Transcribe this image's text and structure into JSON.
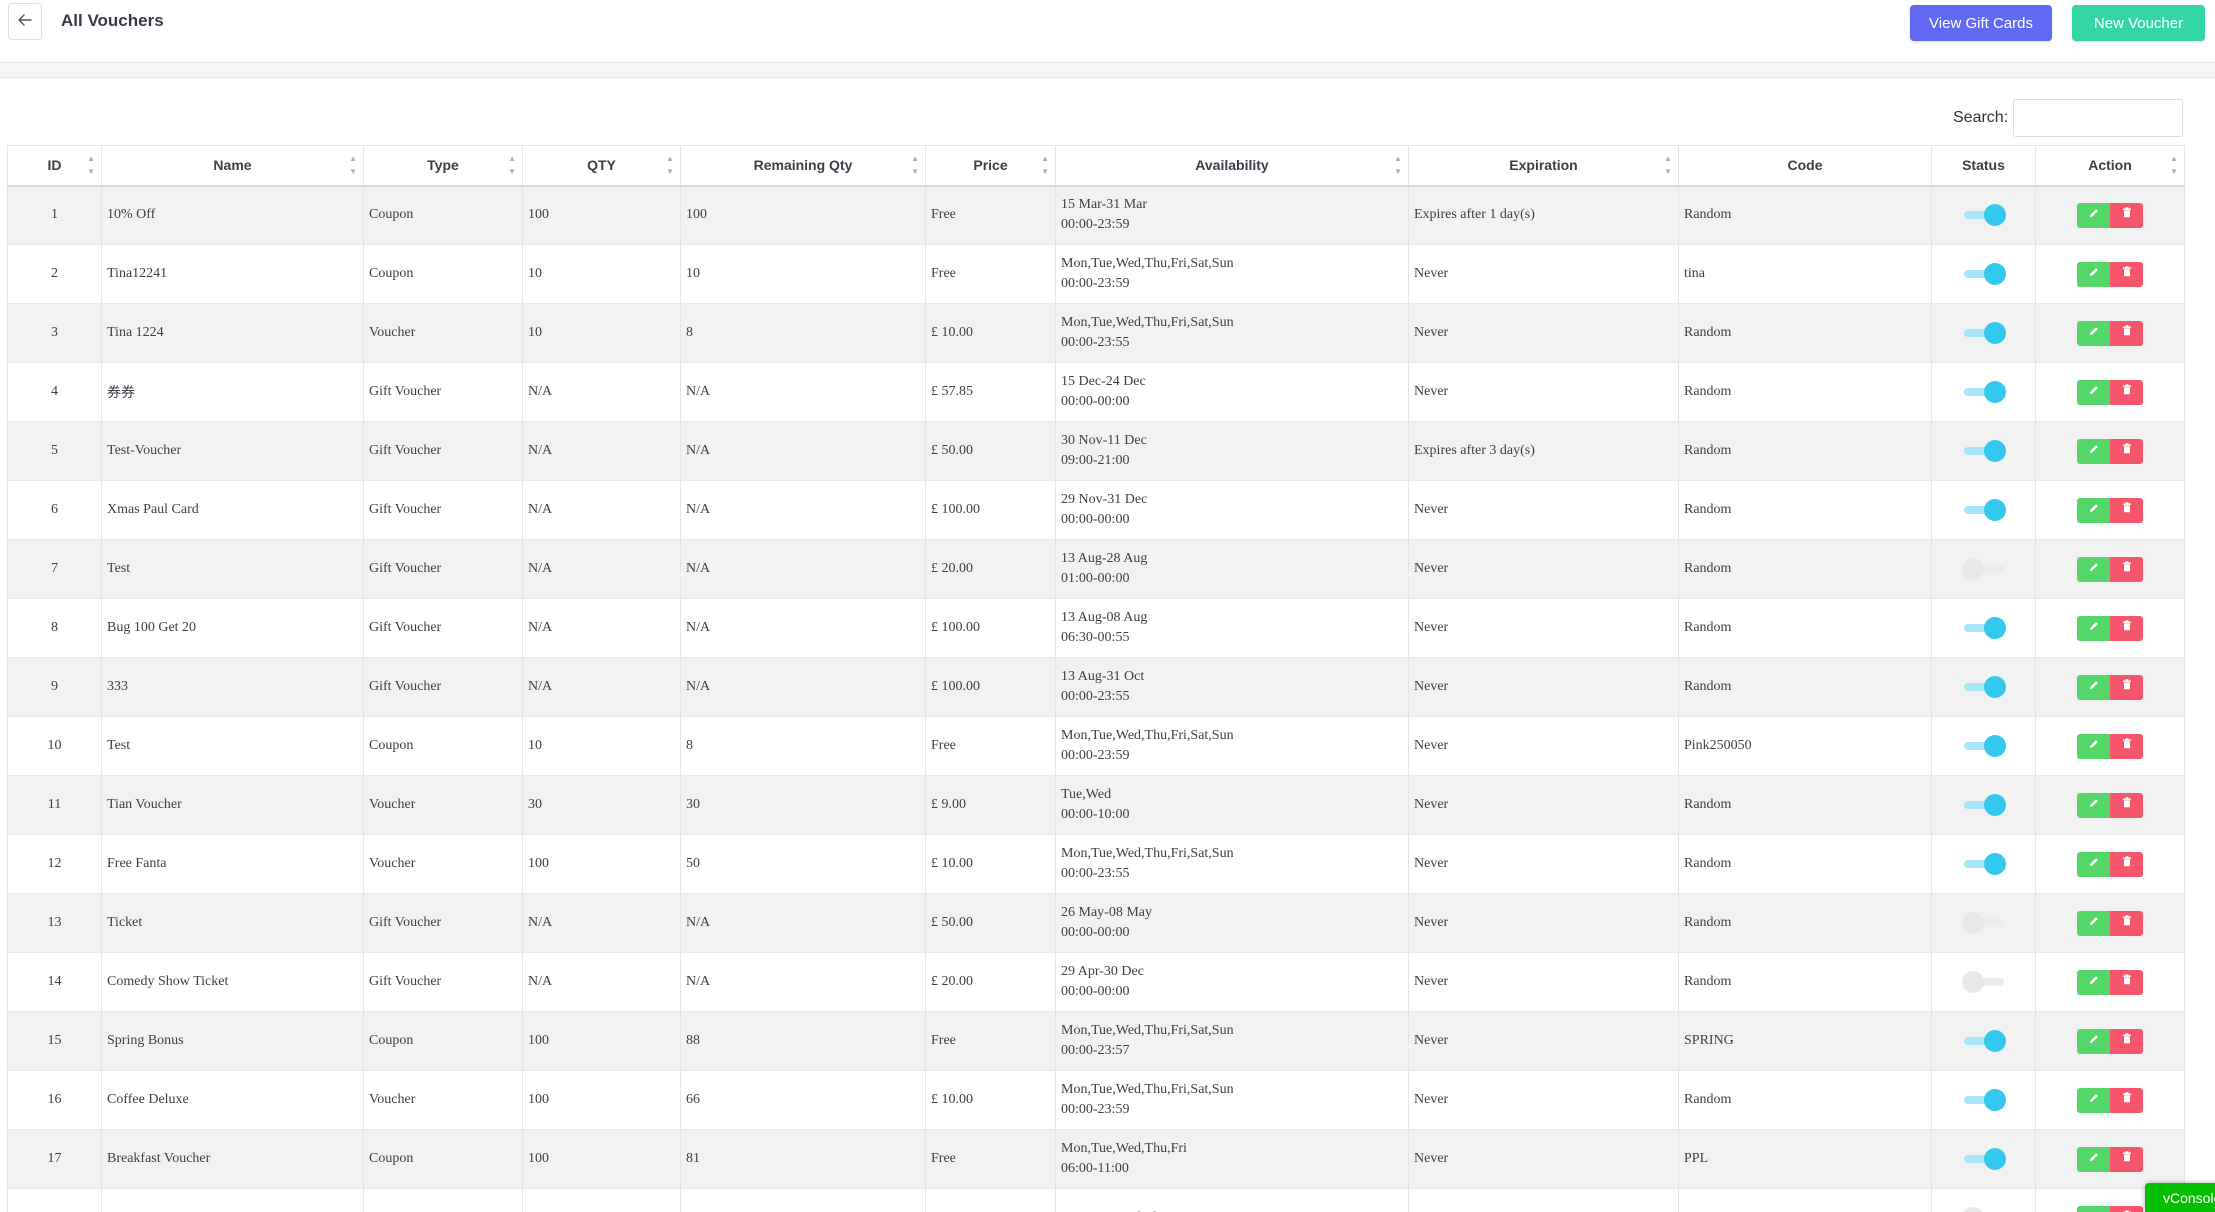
{
  "header": {
    "title": "All Vouchers",
    "view_gift_cards_label": "View Gift Cards",
    "new_voucher_label": "New Voucher"
  },
  "search": {
    "label": "Search:",
    "value": ""
  },
  "table": {
    "columns": [
      "ID",
      "Name",
      "Type",
      "QTY",
      "Remaining Qty",
      "Price",
      "Availability",
      "Expiration",
      "Code",
      "Status",
      "Action"
    ],
    "rows": [
      {
        "id": "1",
        "name": "10% Off",
        "type": "Coupon",
        "qty": "100",
        "remaining": "100",
        "price": "Free",
        "availability": [
          "15 Mar-31 Mar",
          "00:00-23:59"
        ],
        "expiration": "Expires after 1 day(s)",
        "code": "Random",
        "status": true
      },
      {
        "id": "2",
        "name": "Tina12241",
        "type": "Coupon",
        "qty": "10",
        "remaining": "10",
        "price": "Free",
        "availability": [
          "Mon,Tue,Wed,Thu,Fri,Sat,Sun",
          "00:00-23:59"
        ],
        "expiration": "Never",
        "code": "tina",
        "status": true
      },
      {
        "id": "3",
        "name": "Tina 1224",
        "type": "Voucher",
        "qty": "10",
        "remaining": "8",
        "price": "£ 10.00",
        "availability": [
          "Mon,Tue,Wed,Thu,Fri,Sat,Sun",
          "00:00-23:55"
        ],
        "expiration": "Never",
        "code": "Random",
        "status": true
      },
      {
        "id": "4",
        "name": "券券",
        "type": "Gift Voucher",
        "qty": "N/A",
        "remaining": "N/A",
        "price": "£ 57.85",
        "availability": [
          "15 Dec-24 Dec",
          "00:00-00:00"
        ],
        "expiration": "Never",
        "code": "Random",
        "status": true
      },
      {
        "id": "5",
        "name": "Test-Voucher",
        "type": "Gift Voucher",
        "qty": "N/A",
        "remaining": "N/A",
        "price": "£ 50.00",
        "availability": [
          "30 Nov-11 Dec",
          "09:00-21:00"
        ],
        "expiration": "Expires after 3 day(s)",
        "code": "Random",
        "status": true
      },
      {
        "id": "6",
        "name": "Xmas Paul Card",
        "type": "Gift Voucher",
        "qty": "N/A",
        "remaining": "N/A",
        "price": "£ 100.00",
        "availability": [
          "29 Nov-31 Dec",
          "00:00-00:00"
        ],
        "expiration": "Never",
        "code": "Random",
        "status": true
      },
      {
        "id": "7",
        "name": "Test",
        "type": "Gift Voucher",
        "qty": "N/A",
        "remaining": "N/A",
        "price": "£ 20.00",
        "availability": [
          "13 Aug-28 Aug",
          "01:00-00:00"
        ],
        "expiration": "Never",
        "code": "Random",
        "status": false
      },
      {
        "id": "8",
        "name": "Bug 100 Get 20",
        "type": "Gift Voucher",
        "qty": "N/A",
        "remaining": "N/A",
        "price": "£ 100.00",
        "availability": [
          "13 Aug-08 Aug",
          "06:30-00:55"
        ],
        "expiration": "Never",
        "code": "Random",
        "status": true
      },
      {
        "id": "9",
        "name": "333",
        "type": "Gift Voucher",
        "qty": "N/A",
        "remaining": "N/A",
        "price": "£ 100.00",
        "availability": [
          "13 Aug-31 Oct",
          "00:00-23:55"
        ],
        "expiration": "Never",
        "code": "Random",
        "status": true
      },
      {
        "id": "10",
        "name": "Test",
        "type": "Coupon",
        "qty": "10",
        "remaining": "8",
        "price": "Free",
        "availability": [
          "Mon,Tue,Wed,Thu,Fri,Sat,Sun",
          "00:00-23:59"
        ],
        "expiration": "Never",
        "code": "Pink250050",
        "status": true
      },
      {
        "id": "11",
        "name": "Tian Voucher",
        "type": "Voucher",
        "qty": "30",
        "remaining": "30",
        "price": "£ 9.00",
        "availability": [
          "Tue,Wed",
          "00:00-10:00"
        ],
        "expiration": "Never",
        "code": "Random",
        "status": true
      },
      {
        "id": "12",
        "name": "Free Fanta",
        "type": "Voucher",
        "qty": "100",
        "remaining": "50",
        "price": "£ 10.00",
        "availability": [
          "Mon,Tue,Wed,Thu,Fri,Sat,Sun",
          "00:00-23:55"
        ],
        "expiration": "Never",
        "code": "Random",
        "status": true
      },
      {
        "id": "13",
        "name": "Ticket",
        "type": "Gift Voucher",
        "qty": "N/A",
        "remaining": "N/A",
        "price": "£ 50.00",
        "availability": [
          "26 May-08 May",
          "00:00-00:00"
        ],
        "expiration": "Never",
        "code": "Random",
        "status": false
      },
      {
        "id": "14",
        "name": "Comedy Show Ticket",
        "type": "Gift Voucher",
        "qty": "N/A",
        "remaining": "N/A",
        "price": "£ 20.00",
        "availability": [
          "29 Apr-30 Dec",
          "00:00-00:00"
        ],
        "expiration": "Never",
        "code": "Random",
        "status": false
      },
      {
        "id": "15",
        "name": "Spring Bonus",
        "type": "Coupon",
        "qty": "100",
        "remaining": "88",
        "price": "Free",
        "availability": [
          "Mon,Tue,Wed,Thu,Fri,Sat,Sun",
          "00:00-23:57"
        ],
        "expiration": "Never",
        "code": "SPRING",
        "status": true
      },
      {
        "id": "16",
        "name": "Coffee Deluxe",
        "type": "Voucher",
        "qty": "100",
        "remaining": "66",
        "price": "£ 10.00",
        "availability": [
          "Mon,Tue,Wed,Thu,Fri,Sat,Sun",
          "00:00-23:59"
        ],
        "expiration": "Never",
        "code": "Random",
        "status": true
      },
      {
        "id": "17",
        "name": "Breakfast Voucher",
        "type": "Coupon",
        "qty": "100",
        "remaining": "81",
        "price": "Free",
        "availability": [
          "Mon,Tue,Wed,Thu,Fri",
          "06:00-11:00"
        ],
        "expiration": "Never",
        "code": "PPL",
        "status": true
      },
      {
        "id": "",
        "name": "",
        "type": "",
        "qty": "",
        "remaining": "",
        "price": "",
        "availability": [
          "Mon,Tue,Wed,Thu,Fri,Sat,Sun",
          ""
        ],
        "expiration": "",
        "code": "",
        "status": false
      }
    ]
  },
  "icons": {
    "back": "arrow-left-icon",
    "sort": "sort-icon",
    "edit": "pencil-icon",
    "delete": "trash-icon"
  },
  "colors": {
    "primary_button": "#6168f2",
    "success_button": "#35d6a5",
    "toggle_on": "#33c9ee",
    "edit": "#53d769",
    "delete": "#f5566b",
    "vconsole": "#04be02"
  },
  "vconsole_label": "vConsole"
}
